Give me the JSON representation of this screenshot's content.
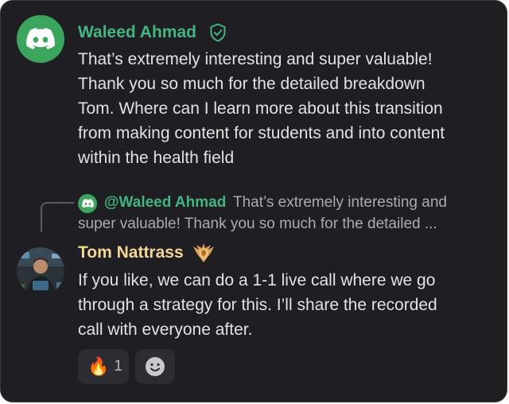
{
  "message1": {
    "author": "Waleed Ahmad",
    "lines": [
      "That’s extremely interesting and super valuable!",
      "Thank you so much for the detailed breakdown",
      "Tom. Where can I learn more about this transition",
      "from making content for students and into content",
      "within the health field"
    ]
  },
  "reply_preview": {
    "mention": "@Waleed Ahmad",
    "text_line1": "That’s extremely interesting and",
    "text_line2": "super valuable! Thank you so much for the detailed ..."
  },
  "message2": {
    "author": "Tom Nattrass",
    "lines": [
      "If you like, we can do a 1-1 live call where we go",
      "through a strategy for this. I’ll share the recorded",
      "call with everyone after."
    ]
  },
  "reactions": [
    {
      "emoji": "🔥",
      "count": "1"
    },
    {
      "icon": "add-reaction-icon"
    }
  ],
  "colors": {
    "background": "#1f1f23",
    "author1": "#43b581",
    "author2": "#f3d594",
    "text": "#e1e2e5",
    "muted": "#a9abb2"
  }
}
